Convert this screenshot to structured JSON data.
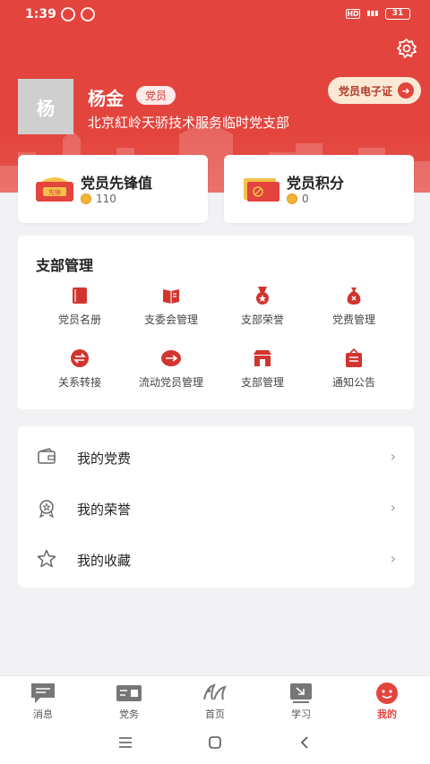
{
  "status_bar": {
    "time": "1:39",
    "battery": "31"
  },
  "profile": {
    "avatar_text": "杨",
    "name": "杨金",
    "role": "党员",
    "organization": "北京紅岭天骄技术服务临时党支部",
    "ecard_label": "党员电子证"
  },
  "stats": [
    {
      "title": "党员先锋值",
      "value": "110",
      "icon": "pioneer-badge-icon"
    },
    {
      "title": "党员积分",
      "value": "0",
      "icon": "points-folder-icon"
    }
  ],
  "branch": {
    "title": "支部管理",
    "items": [
      {
        "label": "党员名册",
        "icon": "book-icon"
      },
      {
        "label": "支委会管理",
        "icon": "committee-icon"
      },
      {
        "label": "支部荣誉",
        "icon": "medal-icon"
      },
      {
        "label": "党费管理",
        "icon": "money-bag-icon"
      },
      {
        "label": "关系转接",
        "icon": "transfer-icon"
      },
      {
        "label": "流动党员管理",
        "icon": "mobile-member-icon"
      },
      {
        "label": "支部管理",
        "icon": "store-icon"
      },
      {
        "label": "通知公告",
        "icon": "notice-icon"
      }
    ]
  },
  "menu": [
    {
      "label": "我的党费",
      "icon": "wallet-icon"
    },
    {
      "label": "我的荣誉",
      "icon": "honor-icon"
    },
    {
      "label": "我的收藏",
      "icon": "star-icon"
    }
  ],
  "tabs": [
    {
      "label": "消息",
      "icon": "message-icon"
    },
    {
      "label": "党务",
      "icon": "party-affairs-icon"
    },
    {
      "label": "首页",
      "icon": "home-logo-icon"
    },
    {
      "label": "学习",
      "icon": "study-icon"
    },
    {
      "label": "我的",
      "icon": "profile-icon",
      "active": true
    }
  ],
  "colors": {
    "primary": "#e3443d",
    "background": "#f2f2f4",
    "badge_bg": "#fdecea",
    "ecard_bg": "#fbe9d5"
  }
}
